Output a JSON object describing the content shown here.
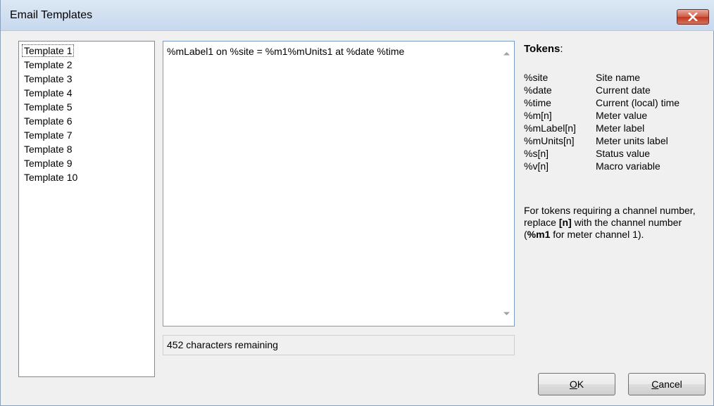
{
  "window": {
    "title": "Email Templates"
  },
  "templates": {
    "items": [
      "Template 1",
      "Template 2",
      "Template 3",
      "Template 4",
      "Template 5",
      "Template 6",
      "Template 7",
      "Template 8",
      "Template 9",
      "Template 10"
    ],
    "selected_index": 0
  },
  "editor": {
    "value": "%mLabel1 on %site = %m1%mUnits1 at %date %time"
  },
  "status": {
    "chars_remaining": "452 characters remaining"
  },
  "tokens": {
    "title": "Tokens",
    "title_suffix": ":",
    "rows": [
      {
        "name": "%site",
        "desc": "Site name"
      },
      {
        "name": "%date",
        "desc": "Current date"
      },
      {
        "name": "%time",
        "desc": "Current (local) time"
      },
      {
        "name": "%m[n]",
        "desc": "Meter value"
      },
      {
        "name": "%mLabel[n]",
        "desc": "Meter label"
      },
      {
        "name": "%mUnits[n]",
        "desc": "Meter units label"
      },
      {
        "name": "%s[n]",
        "desc": "Status value"
      },
      {
        "name": "%v[n]",
        "desc": "Macro variable"
      }
    ],
    "help": {
      "part1": "For tokens requiring a channel number, replace ",
      "bold1": "[n]",
      "part2": " with the channel number (",
      "bold2": "%m1",
      "part3": " for meter channel 1)."
    }
  },
  "buttons": {
    "ok_mnemonic": "O",
    "ok_rest": "K",
    "cancel_mnemonic": "C",
    "cancel_rest": "ancel"
  },
  "colors": {
    "title_bar": "#c8d9ee",
    "close_button": "#c1391f",
    "dialog_bg": "#f0f0f0"
  }
}
